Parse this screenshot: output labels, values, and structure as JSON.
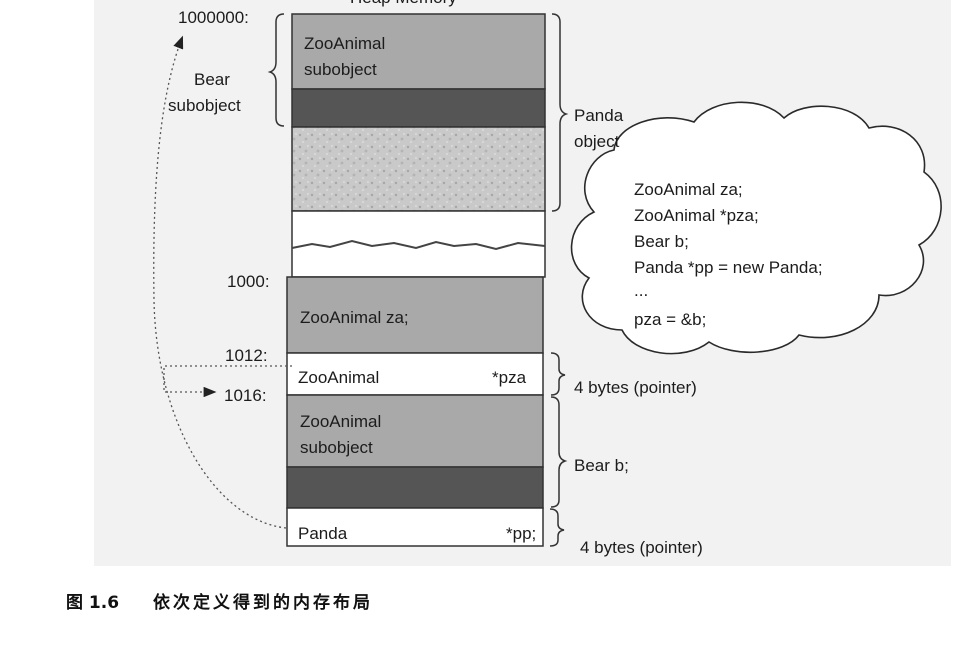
{
  "figure": {
    "header": "Heap Memory",
    "addresses": [
      "1000000:",
      "1000:",
      "1012:",
      "1016:"
    ],
    "heap_labels": {
      "zooanimal_line1": "ZooAnimal",
      "zooanimal_line2": "subobject"
    },
    "left_labels": {
      "bear_line1": "Bear",
      "bear_line2": "subobject"
    },
    "right_labels": {
      "panda_line1": "Panda",
      "panda_line2": "object",
      "pointer_size_1": "4 bytes (pointer)",
      "bear_b": "Bear b;",
      "pointer_size_2": "4 bytes (pointer)"
    },
    "stack_labels": {
      "za": "ZooAnimal za;",
      "pza_type": "ZooAnimal",
      "pza_name": "*pza",
      "bear_line1": "ZooAnimal",
      "bear_line2": "subobject",
      "pp_type": "Panda",
      "pp_name": "*pp;"
    },
    "code_cloud": [
      "ZooAnimal za;",
      "ZooAnimal *pza;",
      "Bear b;",
      "Panda *pp = new Panda;",
      "...",
      "pza = &b;"
    ]
  },
  "caption": {
    "number": "图 1.6",
    "text": "依次定义得到的内存布局"
  }
}
